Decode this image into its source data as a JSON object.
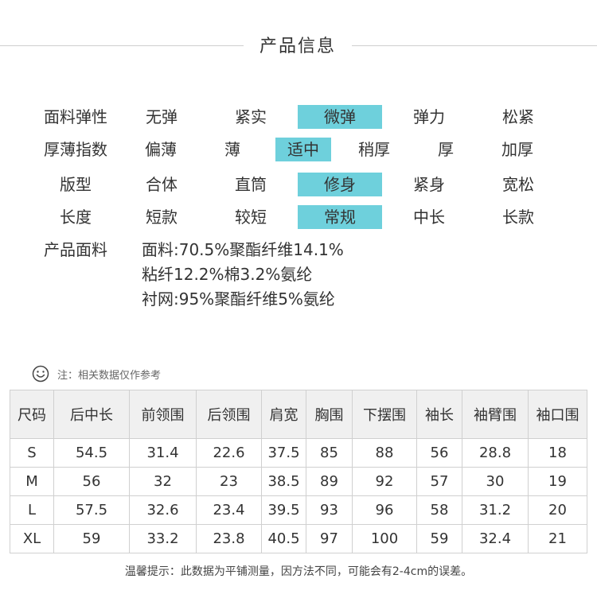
{
  "section_title": "产品信息",
  "attributes": [
    {
      "label": "面料弹性",
      "options": [
        "无弹",
        "紧实",
        "微弹",
        "弹力",
        "松紧"
      ],
      "selected": 2
    },
    {
      "label": "厚薄指数",
      "options": [
        "偏薄",
        "薄",
        "适中",
        "稍厚",
        "厚",
        "加厚"
      ],
      "selected": 2
    },
    {
      "label": "版型",
      "options": [
        "合体",
        "直筒",
        "修身",
        "紧身",
        "宽松"
      ],
      "selected": 2
    },
    {
      "label": "长度",
      "options": [
        "短款",
        "较短",
        "常规",
        "中长",
        "长款"
      ],
      "selected": 2
    }
  ],
  "fabric": {
    "label": "产品面料",
    "lines": [
      "面料:70.5%聚酯纤维14.1%",
      "粘纤12.2%棉3.2%氨纶",
      "衬网:95%聚酯纤维5%氨纶"
    ]
  },
  "note": "注：相关数据仅作参考",
  "size_table": {
    "headers": [
      "尺码",
      "后中长",
      "前领围",
      "后领围",
      "肩宽",
      "胸围",
      "下摆围",
      "袖长",
      "袖臂围",
      "袖口围"
    ],
    "rows": [
      [
        "S",
        "54.5",
        "31.4",
        "22.6",
        "37.5",
        "85",
        "88",
        "56",
        "28.8",
        "18"
      ],
      [
        "M",
        "56",
        "32",
        "23",
        "38.5",
        "89",
        "92",
        "57",
        "30",
        "19"
      ],
      [
        "L",
        "57.5",
        "32.6",
        "23.4",
        "39.5",
        "93",
        "96",
        "58",
        "31.2",
        "20"
      ],
      [
        "XL",
        "59",
        "33.2",
        "23.8",
        "40.5",
        "97",
        "100",
        "59",
        "32.4",
        "21"
      ]
    ]
  },
  "footer_note": "温馨提示：此数据为平铺测量，因方法不同，可能会有2-4cm的误差。",
  "colors": {
    "highlight": "#6ed0dc",
    "line": "#cfcfcf"
  }
}
